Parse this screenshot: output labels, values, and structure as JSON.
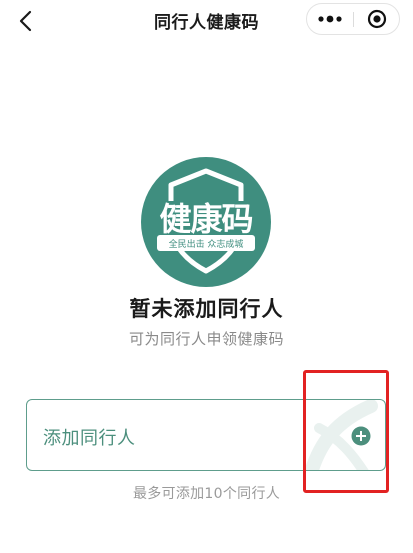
{
  "navbar": {
    "title": "同行人健康码",
    "back_icon": "chevron-left-icon",
    "more_icon": "more-dots-icon",
    "close_icon": "target-circle-icon"
  },
  "logo": {
    "main_text": "健康码",
    "slogan": "全民出击 众志成城",
    "color": "#3f8e7f"
  },
  "empty_state": {
    "title": "暂未添加同行人",
    "subtitle": "可为同行人申领健康码"
  },
  "add_card": {
    "label": "添加同行人",
    "icon": "plus-circle-icon",
    "accent_color": "#4c8f7d"
  },
  "hint": "最多可添加10个同行人",
  "annotation": {
    "color": "#e22222"
  }
}
